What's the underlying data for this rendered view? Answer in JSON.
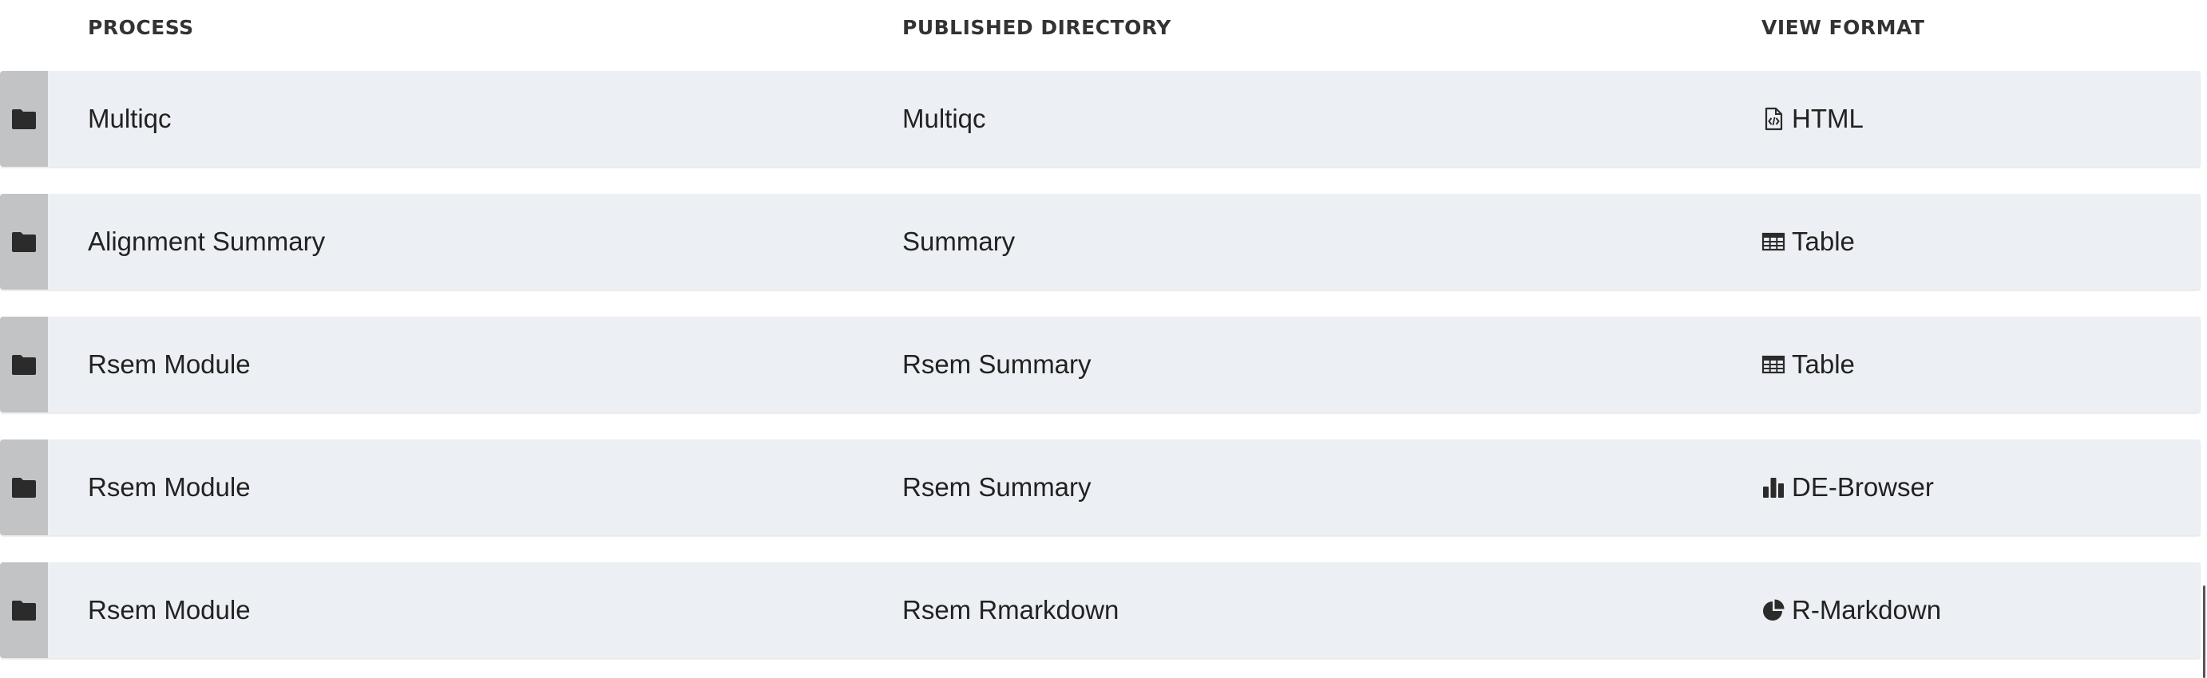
{
  "header": {
    "process": "PROCESS",
    "published_directory": "PUBLISHED DIRECTORY",
    "view_format": "VIEW FORMAT"
  },
  "rows": [
    {
      "process": "Multiqc",
      "directory": "Multiqc",
      "format": "HTML",
      "format_icon": "file-code-icon"
    },
    {
      "process": "Alignment Summary",
      "directory": "Summary",
      "format": "Table",
      "format_icon": "table-icon"
    },
    {
      "process": "Rsem Module",
      "directory": "Rsem Summary",
      "format": "Table",
      "format_icon": "table-icon"
    },
    {
      "process": "Rsem Module",
      "directory": "Rsem Summary",
      "format": "DE-Browser",
      "format_icon": "bar-chart-icon"
    },
    {
      "process": "Rsem Module",
      "directory": "Rsem Rmarkdown",
      "format": "R-Markdown",
      "format_icon": "pie-chart-icon"
    }
  ],
  "colors": {
    "row_bg": "#eceff3",
    "handle_bg": "#c1c3c5",
    "text": "#222222",
    "icon": "#2b2b2b"
  },
  "row_handle_icon": "folder-icon"
}
